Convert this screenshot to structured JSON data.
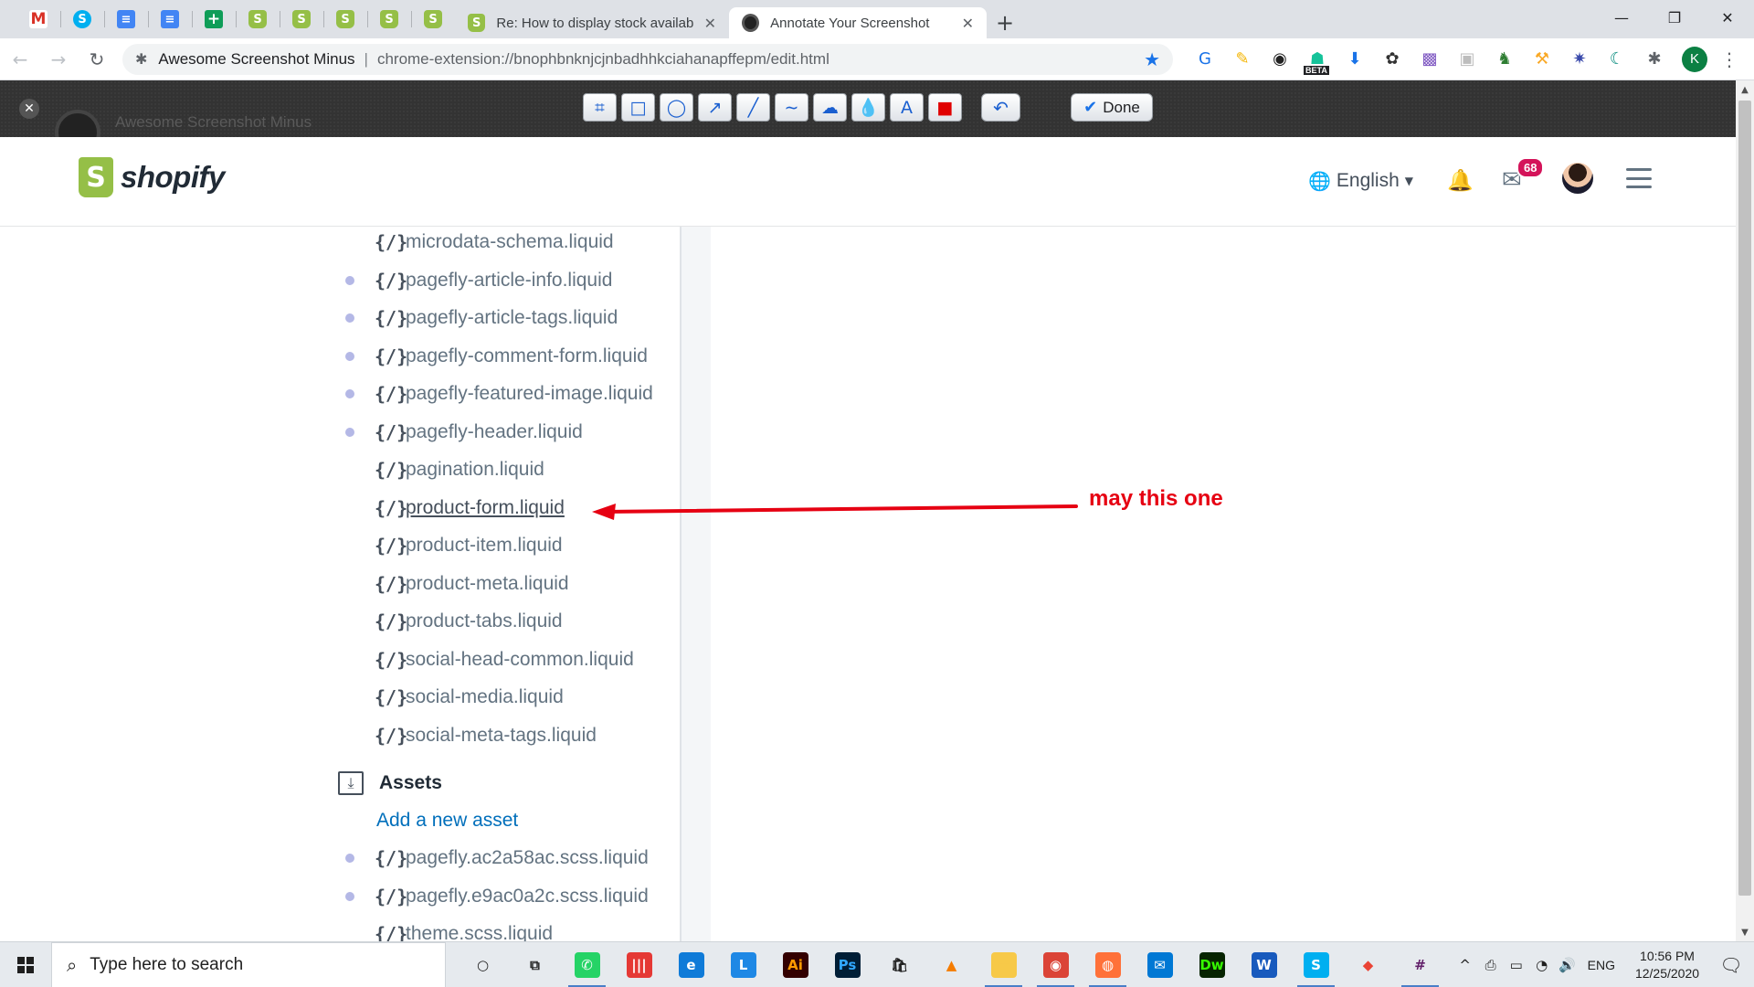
{
  "browser": {
    "pinned_tabs": [
      {
        "icon": "gmail-icon",
        "glyph": "M",
        "cls": "fav-gmail"
      },
      {
        "icon": "skype-icon",
        "glyph": "S",
        "cls": "fav-skype"
      },
      {
        "icon": "docs-icon",
        "glyph": "≡",
        "cls": "fav-docs"
      },
      {
        "icon": "docs-icon",
        "glyph": "≡",
        "cls": "fav-docs"
      },
      {
        "icon": "sheets-icon",
        "glyph": "+",
        "cls": "fav-sheets"
      },
      {
        "icon": "shopify-icon",
        "glyph": "S",
        "cls": "fav-shop"
      },
      {
        "icon": "shopify-icon",
        "glyph": "S",
        "cls": "fav-shop"
      },
      {
        "icon": "shopify-icon",
        "glyph": "S",
        "cls": "fav-shop"
      },
      {
        "icon": "shopify-icon",
        "glyph": "S",
        "cls": "fav-shop"
      },
      {
        "icon": "shopify-icon",
        "glyph": "S",
        "cls": "fav-shop"
      }
    ],
    "tabs": [
      {
        "title": "Re: How to display stock availabi",
        "active": false
      },
      {
        "title": "Annotate Your Screenshot",
        "active": true
      }
    ],
    "close_glyph": "✕",
    "new_tab_glyph": "+",
    "window_controls": [
      "—",
      "❐",
      "✕"
    ],
    "omnibox": {
      "site": "Awesome Screenshot Minus",
      "separator": "|",
      "url": "chrome-extension://bnophbnknjcjnbadhhkciahanapffepm/edit.html"
    },
    "profile_initial": "K",
    "beta_label": "BETA"
  },
  "annotator": {
    "brand": "Awesome Screenshot Minus",
    "tools": [
      {
        "name": "crop-tool",
        "glyph": "⌗"
      },
      {
        "name": "rectangle-tool",
        "glyph": "□"
      },
      {
        "name": "ellipse-tool",
        "glyph": "◯"
      },
      {
        "name": "arrow-tool",
        "glyph": "↗"
      },
      {
        "name": "line-tool",
        "glyph": "╱"
      },
      {
        "name": "curve-tool",
        "glyph": "∼"
      },
      {
        "name": "blur-tool",
        "glyph": "☁"
      },
      {
        "name": "blur-drop-tool",
        "glyph": "💧"
      },
      {
        "name": "text-tool",
        "glyph": "A"
      },
      {
        "name": "color-tool",
        "glyph": "■"
      }
    ],
    "undo_glyph": "↶",
    "done_label": "Done"
  },
  "shopify": {
    "logo_text": "shopify",
    "language": "English",
    "mail_badge": "68"
  },
  "files": {
    "items": [
      {
        "name": "microdata-schema.liquid",
        "dot": false
      },
      {
        "name": "pagefly-article-info.liquid",
        "dot": true
      },
      {
        "name": "pagefly-article-tags.liquid",
        "dot": true
      },
      {
        "name": "pagefly-comment-form.liquid",
        "dot": true
      },
      {
        "name": "pagefly-featured-image.liquid",
        "dot": true
      },
      {
        "name": "pagefly-header.liquid",
        "dot": true
      },
      {
        "name": "pagination.liquid",
        "dot": false
      },
      {
        "name": "product-form.liquid",
        "dot": false,
        "link": true
      },
      {
        "name": "product-item.liquid",
        "dot": false
      },
      {
        "name": "product-meta.liquid",
        "dot": false
      },
      {
        "name": "product-tabs.liquid",
        "dot": false
      },
      {
        "name": "social-head-common.liquid",
        "dot": false
      },
      {
        "name": "social-media.liquid",
        "dot": false
      },
      {
        "name": "social-meta-tags.liquid",
        "dot": false
      }
    ],
    "code_glyph": "{/}",
    "assets_title": "Assets",
    "add_asset_label": "Add a new asset",
    "assets": [
      {
        "name": "pagefly.ac2a58ac.scss.liquid",
        "dot": true
      },
      {
        "name": "pagefly.e9ac0a2c.scss.liquid",
        "dot": true
      },
      {
        "name": "theme.scss.liquid",
        "dot": false
      }
    ]
  },
  "annotation": {
    "text": "may this one",
    "color": "#e60012"
  },
  "taskbar": {
    "search_placeholder": "Type here to search",
    "apps": [
      {
        "name": "cortana-icon",
        "glyph": "○",
        "bg": "transparent",
        "fg": "#1f1f1f",
        "active": false
      },
      {
        "name": "task-view-icon",
        "glyph": "⧉",
        "bg": "transparent",
        "fg": "#1f1f1f",
        "active": false
      },
      {
        "name": "whatsapp-icon",
        "glyph": "✆",
        "bg": "#25d366",
        "fg": "#ffffff",
        "active": true
      },
      {
        "name": "app-red-icon",
        "glyph": "|||",
        "bg": "#e53935",
        "fg": "#ffffff",
        "active": false
      },
      {
        "name": "edge-icon",
        "glyph": "e",
        "bg": "#0f7bd8",
        "fg": "#ffffff",
        "active": false
      },
      {
        "name": "app-l-icon",
        "glyph": "L",
        "bg": "#1e88e5",
        "fg": "#ffffff",
        "active": false
      },
      {
        "name": "illustrator-icon",
        "glyph": "Ai",
        "bg": "#330000",
        "fg": "#ff9a00",
        "active": false
      },
      {
        "name": "photoshop-icon",
        "glyph": "Ps",
        "bg": "#001e36",
        "fg": "#31a8ff",
        "active": false
      },
      {
        "name": "store-icon",
        "glyph": "🛍",
        "bg": "transparent",
        "fg": "#1f1f1f",
        "active": false
      },
      {
        "name": "vlc-icon",
        "glyph": "▲",
        "bg": "transparent",
        "fg": "#f57c00",
        "active": false
      },
      {
        "name": "file-explorer-icon",
        "glyph": "▬",
        "bg": "#f7c948",
        "fg": "#f7c948",
        "active": true
      },
      {
        "name": "chrome-icon",
        "glyph": "◉",
        "bg": "#db4437",
        "fg": "#ffffff",
        "active": true
      },
      {
        "name": "firefox-icon",
        "glyph": "◍",
        "bg": "#ff7139",
        "fg": "#ffffff",
        "active": true
      },
      {
        "name": "mail-icon",
        "glyph": "✉",
        "bg": "#0078d4",
        "fg": "#ffffff",
        "active": false
      },
      {
        "name": "dreamweaver-icon",
        "glyph": "Dw",
        "bg": "#072401",
        "fg": "#35fa00",
        "active": false
      },
      {
        "name": "word-icon",
        "glyph": "W",
        "bg": "#185abd",
        "fg": "#ffffff",
        "active": false
      },
      {
        "name": "skype-icon",
        "glyph": "S",
        "bg": "#00aff0",
        "fg": "#ffffff",
        "active": true
      },
      {
        "name": "app-gem-icon",
        "glyph": "◆",
        "bg": "transparent",
        "fg": "#ea4335",
        "active": false
      },
      {
        "name": "slack-icon",
        "glyph": "#",
        "bg": "transparent",
        "fg": "#611f69",
        "active": true
      }
    ],
    "tray_icons": [
      "^",
      "⎙",
      "▭",
      "◔",
      "🔊"
    ],
    "language": "ENG",
    "time": "10:56 PM",
    "date": "12/25/2020"
  }
}
